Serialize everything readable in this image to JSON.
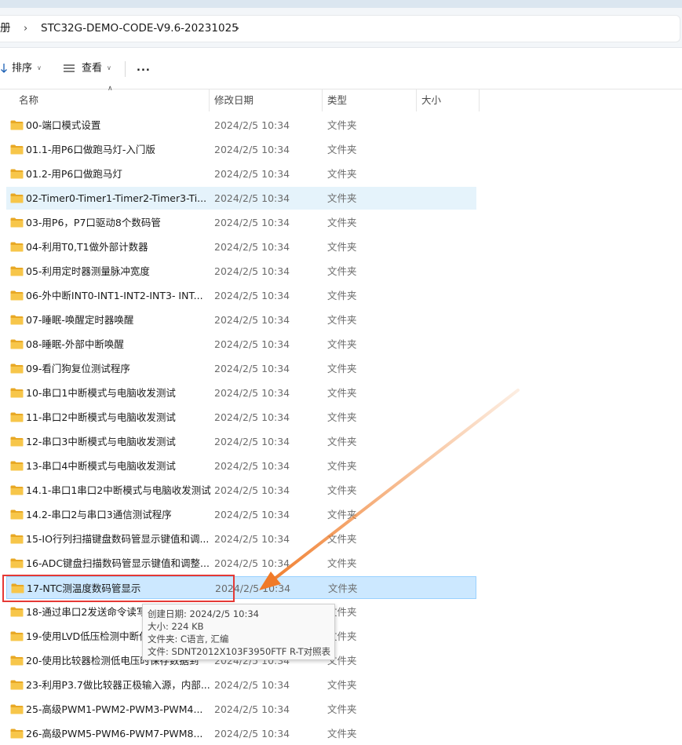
{
  "breadcrumb": {
    "parent_partial": "册",
    "current": "STC32G-DEMO-CODE-V9.6-20231025"
  },
  "toolbar": {
    "sort_label": "排序",
    "view_label": "查看",
    "more_label": "..."
  },
  "columns": {
    "name": "名称",
    "modified": "修改日期",
    "type": "类型",
    "size": "大小"
  },
  "files": [
    {
      "name": "00-端口模式设置",
      "modified": "2024/2/5 10:34",
      "type": "文件夹"
    },
    {
      "name": "01.1-用P6口做跑马灯-入门版",
      "modified": "2024/2/5 10:34",
      "type": "文件夹"
    },
    {
      "name": "01.2-用P6口做跑马灯",
      "modified": "2024/2/5 10:34",
      "type": "文件夹"
    },
    {
      "name": "02-Timer0-Timer1-Timer2-Timer3-Ti...",
      "modified": "2024/2/5 10:34",
      "type": "文件夹",
      "state": "hover"
    },
    {
      "name": "03-用P6，P7口驱动8个数码管",
      "modified": "2024/2/5 10:34",
      "type": "文件夹"
    },
    {
      "name": "04-利用T0,T1做外部计数器",
      "modified": "2024/2/5 10:34",
      "type": "文件夹"
    },
    {
      "name": "05-利用定时器测量脉冲宽度",
      "modified": "2024/2/5 10:34",
      "type": "文件夹"
    },
    {
      "name": "06-外中断INT0-INT1-INT2-INT3- INT...",
      "modified": "2024/2/5 10:34",
      "type": "文件夹"
    },
    {
      "name": "07-睡眠-唤醒定时器唤醒",
      "modified": "2024/2/5 10:34",
      "type": "文件夹"
    },
    {
      "name": "08-睡眠-外部中断唤醒",
      "modified": "2024/2/5 10:34",
      "type": "文件夹"
    },
    {
      "name": "09-看门狗复位测试程序",
      "modified": "2024/2/5 10:34",
      "type": "文件夹"
    },
    {
      "name": "10-串口1中断模式与电脑收发测试",
      "modified": "2024/2/5 10:34",
      "type": "文件夹"
    },
    {
      "name": "11-串口2中断模式与电脑收发测试",
      "modified": "2024/2/5 10:34",
      "type": "文件夹"
    },
    {
      "name": "12-串口3中断模式与电脑收发测试",
      "modified": "2024/2/5 10:34",
      "type": "文件夹"
    },
    {
      "name": "13-串口4中断模式与电脑收发测试",
      "modified": "2024/2/5 10:34",
      "type": "文件夹"
    },
    {
      "name": "14.1-串口1串口2中断模式与电脑收发测试",
      "modified": "2024/2/5 10:34",
      "type": "文件夹"
    },
    {
      "name": "14.2-串口2与串口3通信测试程序",
      "modified": "2024/2/5 10:34",
      "type": "文件夹"
    },
    {
      "name": "15-IO行列扫描键盘数码管显示键值和调...",
      "modified": "2024/2/5 10:34",
      "type": "文件夹"
    },
    {
      "name": "16-ADC键盘扫描数码管显示键值和调整...",
      "modified": "2024/2/5 10:34",
      "type": "文件夹"
    },
    {
      "name": "17-NTC测温度数码管显示",
      "modified": "2024/2/5 10:34",
      "type": "文件夹",
      "state": "selected"
    },
    {
      "name": "18-通过串口2发送命令读写",
      "modified": "",
      "type": "文件夹"
    },
    {
      "name": "19-使用LVD低压检测中断保",
      "modified": "",
      "type": "文件夹"
    },
    {
      "name": "20-使用比较器检测低电压时保存数据到",
      "modified": "2024/2/5 10:34",
      "type": "文件夹"
    },
    {
      "name": "23-利用P3.7做比较器正极输入源，内部...",
      "modified": "2024/2/5 10:34",
      "type": "文件夹"
    },
    {
      "name": "25-高级PWM1-PWM2-PWM3-PWM4...",
      "modified": "2024/2/5 10:34",
      "type": "文件夹"
    },
    {
      "name": "26-高级PWM5-PWM6-PWM7-PWM8...",
      "modified": "2024/2/5 10:34",
      "type": "文件夹"
    }
  ],
  "tooltip": {
    "created": "创建日期: 2024/2/5 10:34",
    "size": "大小: 224 KB",
    "folders": "文件夹: C语言, 汇编",
    "files": "文件: SDNT2012X103F3950FTF R-T对照表"
  },
  "colors": {
    "selected_bg": "#cce8ff",
    "hover_bg": "#e5f3fb",
    "highlight_box": "#e53935",
    "arrow": "#f08a3c",
    "folder": "#f7c64a"
  }
}
